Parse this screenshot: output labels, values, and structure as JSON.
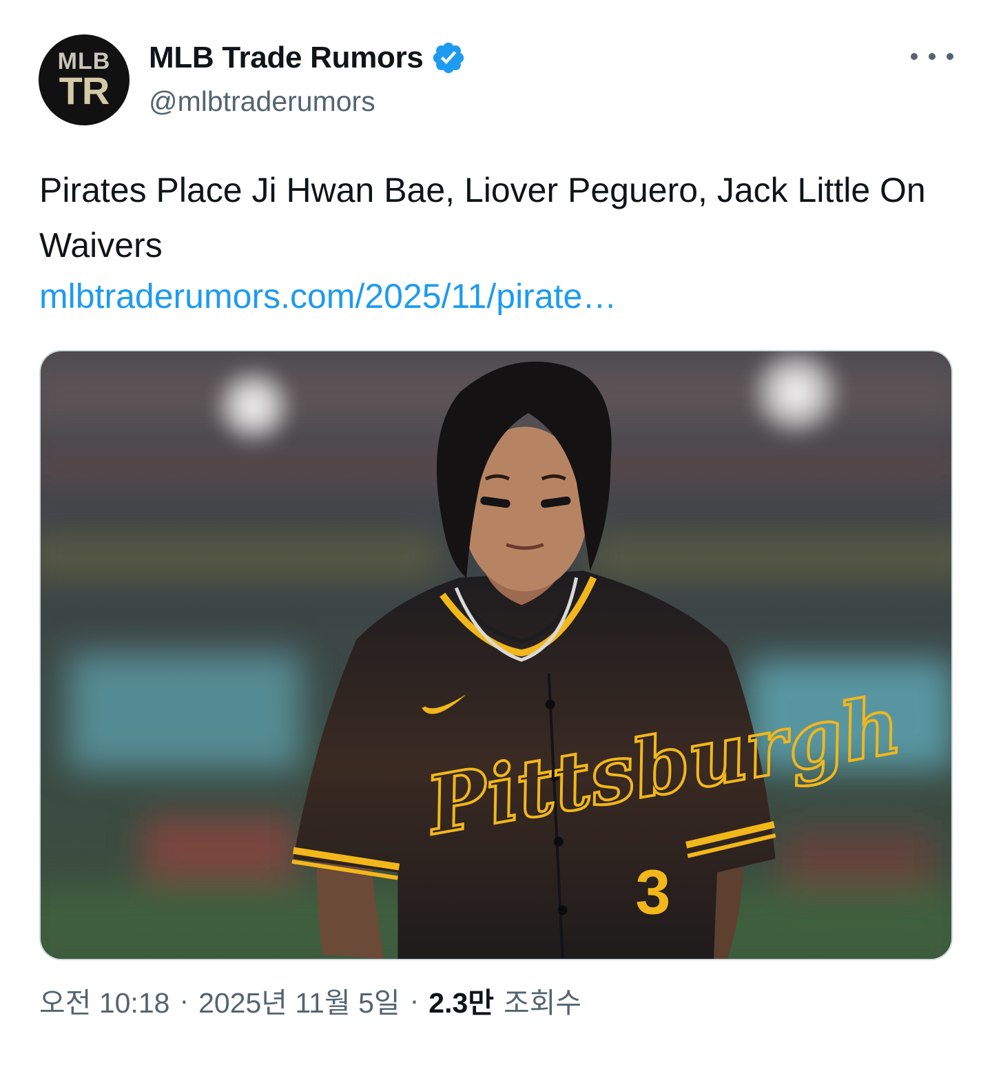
{
  "account": {
    "display_name": "MLB Trade Rumors",
    "handle": "@mlbtraderumors",
    "avatar_line1": "MLB",
    "avatar_line2": "TR",
    "verified": true,
    "verified_color": "#1d9bf0"
  },
  "tweet": {
    "text": "Pirates Place Ji Hwan Bae, Liover Peguero, Jack Little On Waivers",
    "link": "mlbtraderumors.com/2025/11/pirate…",
    "media": {
      "alt": "Pirates player in black Pittsburgh jersey with number 3",
      "jersey_script": "Pittsburgh",
      "jersey_number": "3"
    }
  },
  "meta": {
    "time": "오전 10:18",
    "separator": "·",
    "date": "2025년 11월 5일",
    "views_count": "2.3만",
    "views_label": "조회수"
  },
  "icons": {
    "more": "more-horizontal-icon",
    "verified": "verified-badge-icon"
  },
  "colors": {
    "text_primary": "#0f1419",
    "text_secondary": "#536471",
    "link": "#1d9bf0",
    "jersey_gold": "#f2b71a"
  }
}
